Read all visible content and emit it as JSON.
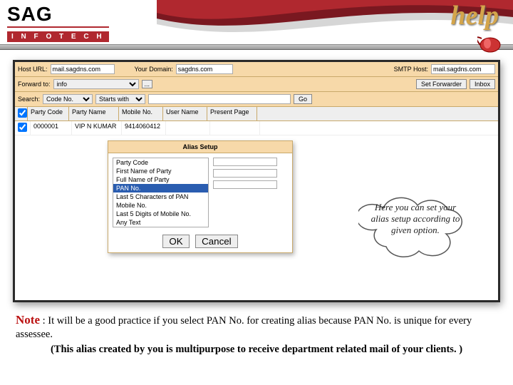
{
  "logo": {
    "sag": "SAG",
    "infotech": "I N F O T E C H"
  },
  "help": "help",
  "toolbar": {
    "host_url_lbl": "Host URL:",
    "host_url_val": "mail.sagdns.com",
    "your_domain_lbl": "Your Domain:",
    "your_domain_val": "sagdns.com",
    "smtp_host_lbl": "SMTP Host:",
    "smtp_host_val": "mail.sagdns.com",
    "forward_to_lbl": "Forward to:",
    "forward_to_val": "info",
    "dots": "...",
    "set_forwarder": "Set Forwarder",
    "inbox": "Inbox",
    "search_lbl": "Search:",
    "search_by": "Code No.",
    "starts_with": "Starts with",
    "go": "Go"
  },
  "grid": {
    "headers": [
      "",
      "Party Code",
      "Party Name",
      "Mobile No.",
      "User Name",
      "Present Page"
    ],
    "rows": [
      [
        "",
        "0000001",
        "VIP N KUMAR",
        "9414060412",
        "",
        ""
      ]
    ]
  },
  "dialog": {
    "title": "Alias Setup",
    "options": [
      "Party Code",
      "First Name of Party",
      "Full Name of Party",
      "PAN No.",
      "Last 5 Characters of PAN",
      "Mobile No.",
      "Last 5 Digits of Mobile No.",
      "Any Text"
    ],
    "selected_index": 3,
    "ok": "OK",
    "cancel": "Cancel"
  },
  "callout": "Here you can set your alias setup according to given option.",
  "note": {
    "label": "Note",
    "line1": ": It will be a good practice if you select PAN No. for creating alias because PAN No. is unique for every  assessee.",
    "line2": "(This alias created by you is multipurpose to receive department related mail of your clients. )"
  }
}
